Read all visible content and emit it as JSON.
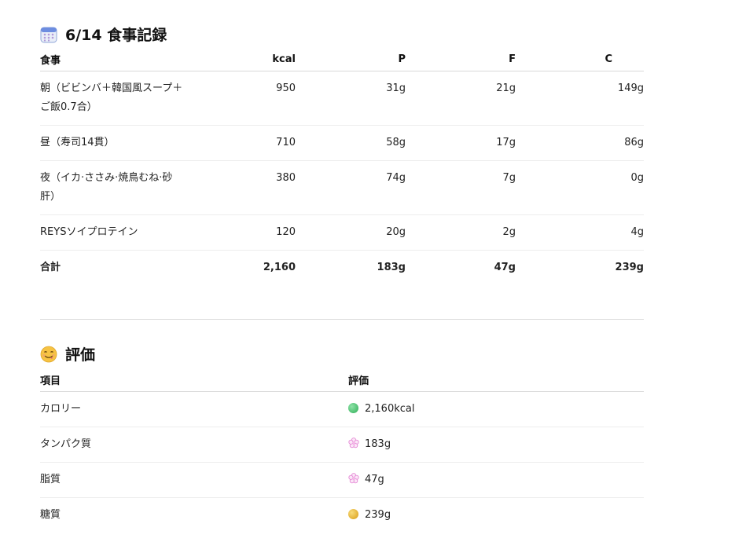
{
  "meal_section": {
    "title": "6/14 食事記録",
    "icon": "calendar-icon",
    "headers": [
      "食事",
      "kcal",
      "P",
      "F",
      "C"
    ],
    "rows": [
      [
        "朝（ビビンバ＋韓国風スープ＋ご飯0.7合）",
        "950",
        "31g",
        "21g",
        "149g"
      ],
      [
        "昼（寿司14貫）",
        "710",
        "58g",
        "17g",
        "86g"
      ],
      [
        "夜（イカ·ささみ·焼鳥むね·砂肝）",
        "380",
        "74g",
        "7g",
        "0g"
      ],
      [
        "REYSソイプロテイン",
        "120",
        "20g",
        "2g",
        "4g"
      ]
    ],
    "total": [
      "合計",
      "2,160",
      "183g",
      "47g",
      "239g"
    ]
  },
  "eval_section": {
    "title": "評価",
    "icon": "face-savoring-icon",
    "headers": [
      "項目",
      "評価"
    ],
    "rows": [
      {
        "item": "カロリー",
        "status_icon": "green-circle-icon",
        "value": "2,160kcal"
      },
      {
        "item": "タンパク質",
        "status_icon": "white-flower-icon",
        "value": "183g"
      },
      {
        "item": "脂質",
        "status_icon": "white-flower-icon",
        "value": "47g"
      },
      {
        "item": "糖質",
        "status_icon": "yellow-circle-icon",
        "value": "239g"
      }
    ]
  },
  "colors": {
    "green": "#3fc46a",
    "yellow": "#e7b52a",
    "flower": "#e58ad6"
  }
}
